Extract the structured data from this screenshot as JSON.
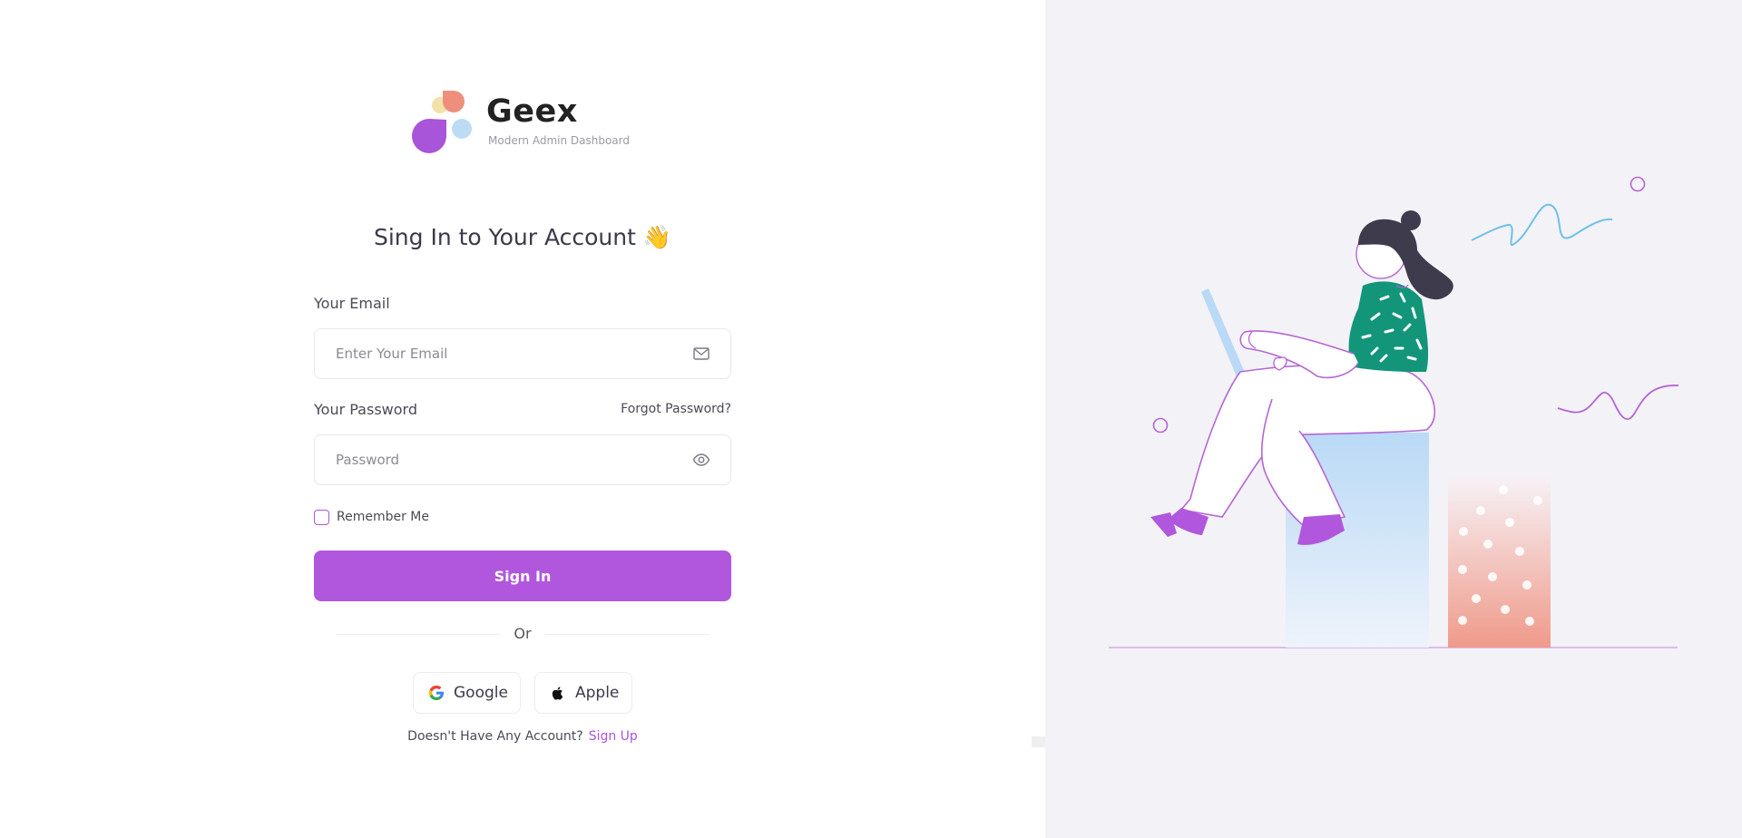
{
  "brand": {
    "name": "Geex",
    "tagline": "Modern Admin Dashboard"
  },
  "form": {
    "heading": "Sing In to Your Account 👋",
    "email_label": "Your Email",
    "email_placeholder": "Enter Your Email",
    "password_label": "Your Password",
    "password_placeholder": "Password",
    "forgot_password": "Forgot Password?",
    "remember_me": "Remember Me",
    "remember_checked": false,
    "submit_label": "Sign In",
    "divider_text": "Or"
  },
  "social": {
    "google_label": "Google",
    "apple_label": "Apple"
  },
  "signup": {
    "prompt": "Doesn't Have Any Account?",
    "link": "Sign Up"
  },
  "icons": {
    "email": "mail-icon",
    "password": "eye-icon",
    "google": "google-icon",
    "apple": "apple-icon"
  },
  "colors": {
    "accent": "#b057dd",
    "right_panel_bg": "#f3f2f7"
  }
}
